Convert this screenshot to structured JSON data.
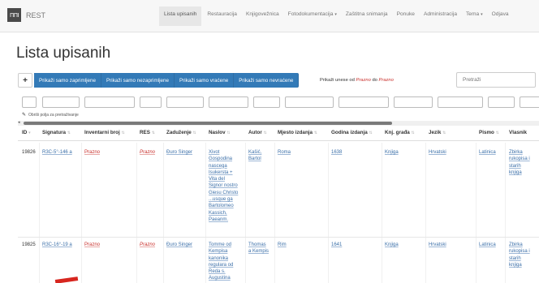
{
  "navbar": {
    "logo_text": "ΠΠΙ",
    "brand": "REST",
    "items": [
      {
        "label": "Lista upisanih",
        "active": true
      },
      {
        "label": "Restauracija"
      },
      {
        "label": "Knjigovežnica"
      },
      {
        "label": "Fotodokumentacija",
        "caret": "▾"
      },
      {
        "label": "Zaštitna snimanja"
      },
      {
        "label": "Ponuke"
      },
      {
        "label": "Administracija"
      },
      {
        "label": "Tema",
        "caret": "▾"
      },
      {
        "label": "Odjava"
      }
    ]
  },
  "page": {
    "title": "Lista upisanih"
  },
  "toolbar": {
    "add_label": "+",
    "filters": [
      "Prikaži samo zaprimljene",
      "Prikaži samo nezaprimljene",
      "Prikaži samo vraćene",
      "Prikaži samo nevraćene"
    ],
    "summary_prefix": "Prikaži unese od ",
    "summary_from": "Prazno",
    "summary_mid": " do ",
    "summary_to": "Prazno",
    "search_placeholder": "Pretraži"
  },
  "clear_fields_label": "Obriši polja za pretraživanje",
  "icons": {
    "pencil": "pencil-icon",
    "scroll_left": "arrow-left-icon"
  },
  "table": {
    "columns": [
      "ID",
      "Signatura",
      "Inventarni broj",
      "RES",
      "Zaduženje",
      "Naslov",
      "Autor",
      "Mjesto izdanja",
      "Godina izdanja",
      "Knj. građa",
      "Jezik",
      "Pismo",
      "Vlasnik"
    ],
    "rows": [
      {
        "id": "19826",
        "signatura": "R3C-5°-146 a",
        "inventarni_broj": "Prazno",
        "res": "Prazno",
        "zaduzenje": "Đuro Singer",
        "naslov": [
          "Xivot",
          "Gospodina",
          "nascega",
          "Isukersta +",
          "Vita del",
          "Signor nostro",
          "Giesu Christo",
          "...usque ga",
          "Bartolomeo",
          "Kassich,",
          "Paeanm."
        ],
        "autor": [
          "Kašić,",
          "Bartol"
        ],
        "mjesto": "Roma",
        "godina": "1638",
        "gradja": "Knjiga",
        "jezik": "Hrvatski",
        "pismo": "Latinica",
        "vlasnik": [
          "Zbirka",
          "rukopisa i",
          "starih",
          "knjiga"
        ]
      },
      {
        "id": "19825",
        "signatura": "R3C-16°-19 a",
        "inventarni_broj": "Prazno",
        "res": "Prazno",
        "zaduzenje": "Đuro Singer",
        "naslov": [
          "Tomme od",
          "Kempisa",
          "kanonika",
          "regulara od",
          "Reda s.",
          "Augustina"
        ],
        "autor": [
          "Thomas",
          "a Kempis"
        ],
        "mjesto": "Rim",
        "godina": "1641",
        "gradja": "Knjiga",
        "jezik": "Hrvatski",
        "pismo": "Latinica",
        "vlasnik": [
          "Zbirka",
          "rukopisa i",
          "starih",
          "knjiga"
        ]
      }
    ]
  },
  "colors": {
    "primary": "#337ab7",
    "link": "#3b6fa8",
    "empty_value": "#c9302c"
  }
}
